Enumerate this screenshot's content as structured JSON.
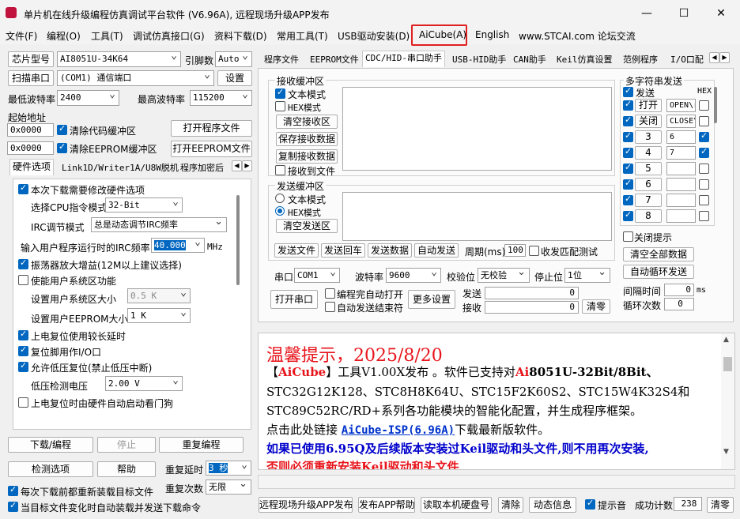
{
  "window": {
    "title": "单片机在线升级编程仿真调试平台软件 (V6.96A), 远程现场升级APP发布",
    "minimize": "—",
    "maximize": "☐",
    "close": "✕"
  },
  "menu": [
    "文件(F)",
    "编程(O)",
    "工具(T)",
    "调试仿真接口(G)",
    "资料下载(D)",
    "常用工具(T)",
    "USB驱动安装(D)",
    "AiCube(A)",
    "English",
    "www.STCAI.com 论坛交流"
  ],
  "left": {
    "chip_button": "芯片型号",
    "chip_value": "AI8051U-34K64",
    "pins_label": "引脚数",
    "pins_value": "Auto",
    "scan_button": "扫描串口",
    "port_value": "(COM1) 通信端口",
    "settings_button": "设置",
    "min_baud_label": "最低波特率",
    "min_baud_value": "2400",
    "max_baud_label": "最高波特率",
    "max_baud_value": "115200",
    "start_addr_label": "起始地址",
    "addr1": "0x0000",
    "clear_code_label": "清除代码缓冲区",
    "open_prog_button": "打开程序文件",
    "addr2": "0x0000",
    "clear_eeprom_label": "清除EEPROM缓冲区",
    "open_eeprom_button": "打开EEPROM文件",
    "tabs": [
      "硬件选项",
      "Link1D/Writer1A/U8W脱机",
      "程序加密后"
    ],
    "hw": {
      "modify_hw": "本次下载需要修改硬件选项",
      "cpu_mode_label": "选择CPU指令模式",
      "cpu_mode_value": "32-Bit",
      "irc_mode_label": "IRC调节模式",
      "irc_mode_value": "总是动态调节IRC频率",
      "irc_freq_label": "输入用户程序运行时的IRC频率",
      "irc_freq_value": "40.000",
      "irc_unit": "MHz",
      "osc_gain": "振荡器放大增益(12M以上建议选择)",
      "user_sys": "使能用户系统区功能",
      "sys_size_label": "设置用户系统区大小",
      "sys_size_value": "0.5 K",
      "eeprom_size_label": "设置用户EEPROM大小",
      "eeprom_size_value": "1   K",
      "power_reset_delay": "上电复位使用较长延时",
      "reset_pin_io": "复位脚用作I/O口",
      "low_volt_reset": "允许低压复位(禁止低压中断)",
      "low_volt_label": "低压检测电压",
      "low_volt_value": "2.00 V",
      "watchdog": "上电复位时由硬件自动启动看门狗"
    },
    "download_button": "下载/编程",
    "stop_button": "停止",
    "reprogram_button": "重复编程",
    "check_button": "检测选项",
    "help_button": "帮助",
    "repeat_delay_label": "重复延时",
    "repeat_delay_value": "3 秒",
    "repeat_count_label": "重复次数",
    "repeat_count_value": "无限",
    "reload_before": "每次下载前都重新装载目标文件",
    "auto_load": "当目标文件变化时自动装载并发送下载命令"
  },
  "right": {
    "tabs": [
      "程序文件",
      "EEPROM文件",
      "CDC/HID-串口助手",
      "USB-HID助手",
      "CAN助手",
      "Keil仿真设置",
      "范例程序",
      "I/O口配"
    ],
    "recv": {
      "title": "接收缓冲区",
      "text_mode": "文本模式",
      "hex_mode": "HEX模式",
      "clear": "清空接收区",
      "save": "保存接收数据",
      "copy": "复制接收数据",
      "to_file": "接收到文件"
    },
    "send": {
      "title": "发送缓冲区",
      "text_mode": "文本模式",
      "hex_mode": "HEX模式",
      "clear": "清空发送区",
      "send_file": "发送文件",
      "send_return": "发送回车",
      "send_data": "发送数据",
      "auto_send": "自动发送",
      "period_label": "周期(ms)",
      "period_value": "100",
      "recv_match": "收发匹配测试"
    },
    "multi": {
      "title": "多字符串发送",
      "send_col": "发送",
      "hex_col": "HEX",
      "rows": [
        {
          "label": "打开",
          "value": "OPEN\\r"
        },
        {
          "label": "关闭",
          "value": "CLOSE\\"
        },
        {
          "label": "3",
          "value": "6"
        },
        {
          "label": "4",
          "value": "7"
        },
        {
          "label": "5",
          "value": ""
        },
        {
          "label": "6",
          "value": ""
        },
        {
          "label": "7",
          "value": ""
        },
        {
          "label": "8",
          "value": ""
        }
      ],
      "close_hint": "关闭提示",
      "clear_all": "清空全部数据",
      "auto_loop": "自动循环发送",
      "interval_label": "间隔时间",
      "interval_value": "0",
      "interval_unit": "ms",
      "loop_label": "循环次数",
      "loop_value": "0"
    },
    "serial": {
      "port_label": "串口",
      "port_value": "COM1",
      "baud_label": "波特率",
      "baud_value": "9600",
      "parity_label": "校验位",
      "parity_value": "无校验",
      "stop_label": "停止位",
      "stop_value": "1位",
      "open_button": "打开串口",
      "auto_open": "编程完自动打开",
      "auto_end": "自动发送结束符",
      "more": "更多设置",
      "send_label": "发送",
      "send_value": "0",
      "recv_label": "接收",
      "recv_value": "0",
      "clear": "清零"
    },
    "notice": {
      "title": "温馨提示，2025/8/20",
      "l1_pre": "【",
      "l1_brand": "AiCube",
      "l1_mid": "】工具V1.00X发布 。软件已支持对",
      "l1_ai": "Ai",
      "l1_chip": "8051U",
      "l1_rest": "-32Bit/8Bit、",
      "l2": "STC32G12K128、STC8H8K64U、STC15F2K60S2、STC15W4K32S4和",
      "l3": "STC89C52RC/RD+系列各功能模块的智能化配置，并生成程序框架。",
      "l4_pre": "点击此处链接 ",
      "l4_link": "AiCube-ISP(6.96A)",
      "l4_post": "下载最新版软件。",
      "l5": "如果已使用6.95Q及后续版本安装过Keil驱动和头文件,则不用再次安装,",
      "l6": "否则必须重新安装Keil驱动和头文件"
    },
    "bottom": {
      "remote_upgrade": "远程现场升级APP发布",
      "publish_help": "发布APP帮助",
      "read_disk": "读取本机硬盘号",
      "clear": "清除",
      "dynamic": "动态信息",
      "beep": "提示音",
      "success_label": "成功计数",
      "success_value": "238",
      "reset": "清零"
    }
  }
}
